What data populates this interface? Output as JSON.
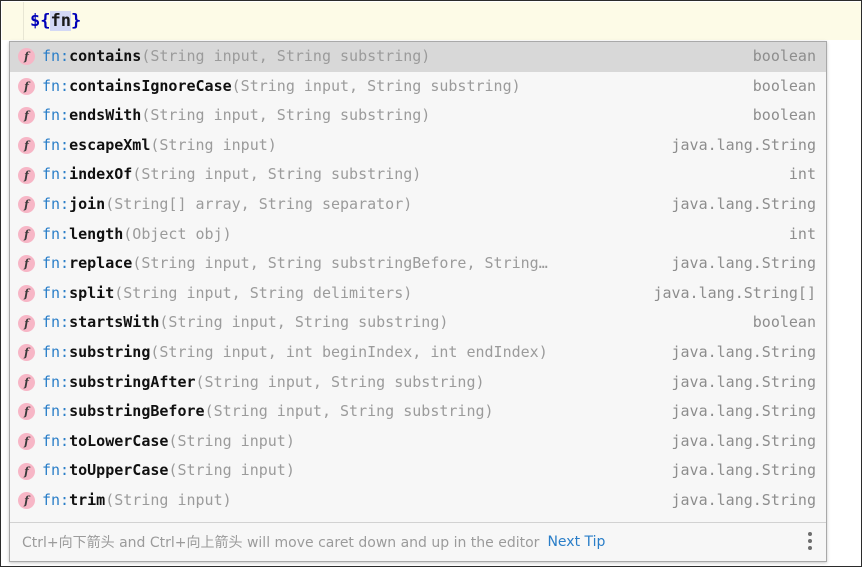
{
  "editor": {
    "code_prefix": "${",
    "code_selected": "fn",
    "code_suffix": "}",
    "full_text": "${fn}"
  },
  "popup": {
    "selected_index": 0,
    "icon_name": "function-icon",
    "icon_glyph": "f",
    "icon_color": "#f7b6c6",
    "accent_color": "#2a7ec8",
    "items": [
      {
        "ns": "fn:",
        "name": "contains",
        "params": "(String input, String substring)",
        "ret": "boolean"
      },
      {
        "ns": "fn:",
        "name": "containsIgnoreCase",
        "params": "(String input, String substring)",
        "ret": "boolean"
      },
      {
        "ns": "fn:",
        "name": "endsWith",
        "params": "(String input, String substring)",
        "ret": "boolean"
      },
      {
        "ns": "fn:",
        "name": "escapeXml",
        "params": "(String input)",
        "ret": "java.lang.String"
      },
      {
        "ns": "fn:",
        "name": "indexOf",
        "params": "(String input, String substring)",
        "ret": "int"
      },
      {
        "ns": "fn:",
        "name": "join",
        "params": "(String[] array, String separator)",
        "ret": "java.lang.String"
      },
      {
        "ns": "fn:",
        "name": "length",
        "params": "(Object obj)",
        "ret": "int"
      },
      {
        "ns": "fn:",
        "name": "replace",
        "params": "(String input, String substringBefore, String…",
        "ret": "java.lang.String"
      },
      {
        "ns": "fn:",
        "name": "split",
        "params": "(String input, String delimiters)",
        "ret": "java.lang.String[]"
      },
      {
        "ns": "fn:",
        "name": "startsWith",
        "params": "(String input, String substring)",
        "ret": "boolean"
      },
      {
        "ns": "fn:",
        "name": "substring",
        "params": "(String input, int beginIndex, int endIndex)",
        "ret": "java.lang.String"
      },
      {
        "ns": "fn:",
        "name": "substringAfter",
        "params": "(String input, String substring)",
        "ret": "java.lang.String"
      },
      {
        "ns": "fn:",
        "name": "substringBefore",
        "params": "(String input, String substring)",
        "ret": "java.lang.String"
      },
      {
        "ns": "fn:",
        "name": "toLowerCase",
        "params": "(String input)",
        "ret": "java.lang.String"
      },
      {
        "ns": "fn:",
        "name": "toUpperCase",
        "params": "(String input)",
        "ret": "java.lang.String"
      },
      {
        "ns": "fn:",
        "name": "trim",
        "params": "(String input)",
        "ret": "java.lang.String"
      }
    ]
  },
  "footer": {
    "hint": "Ctrl+向下箭头 and Ctrl+向上箭头 will move caret down and up in the editor",
    "next_tip_label": "Next Tip",
    "overflow_icon": "more-vertical-icon"
  }
}
